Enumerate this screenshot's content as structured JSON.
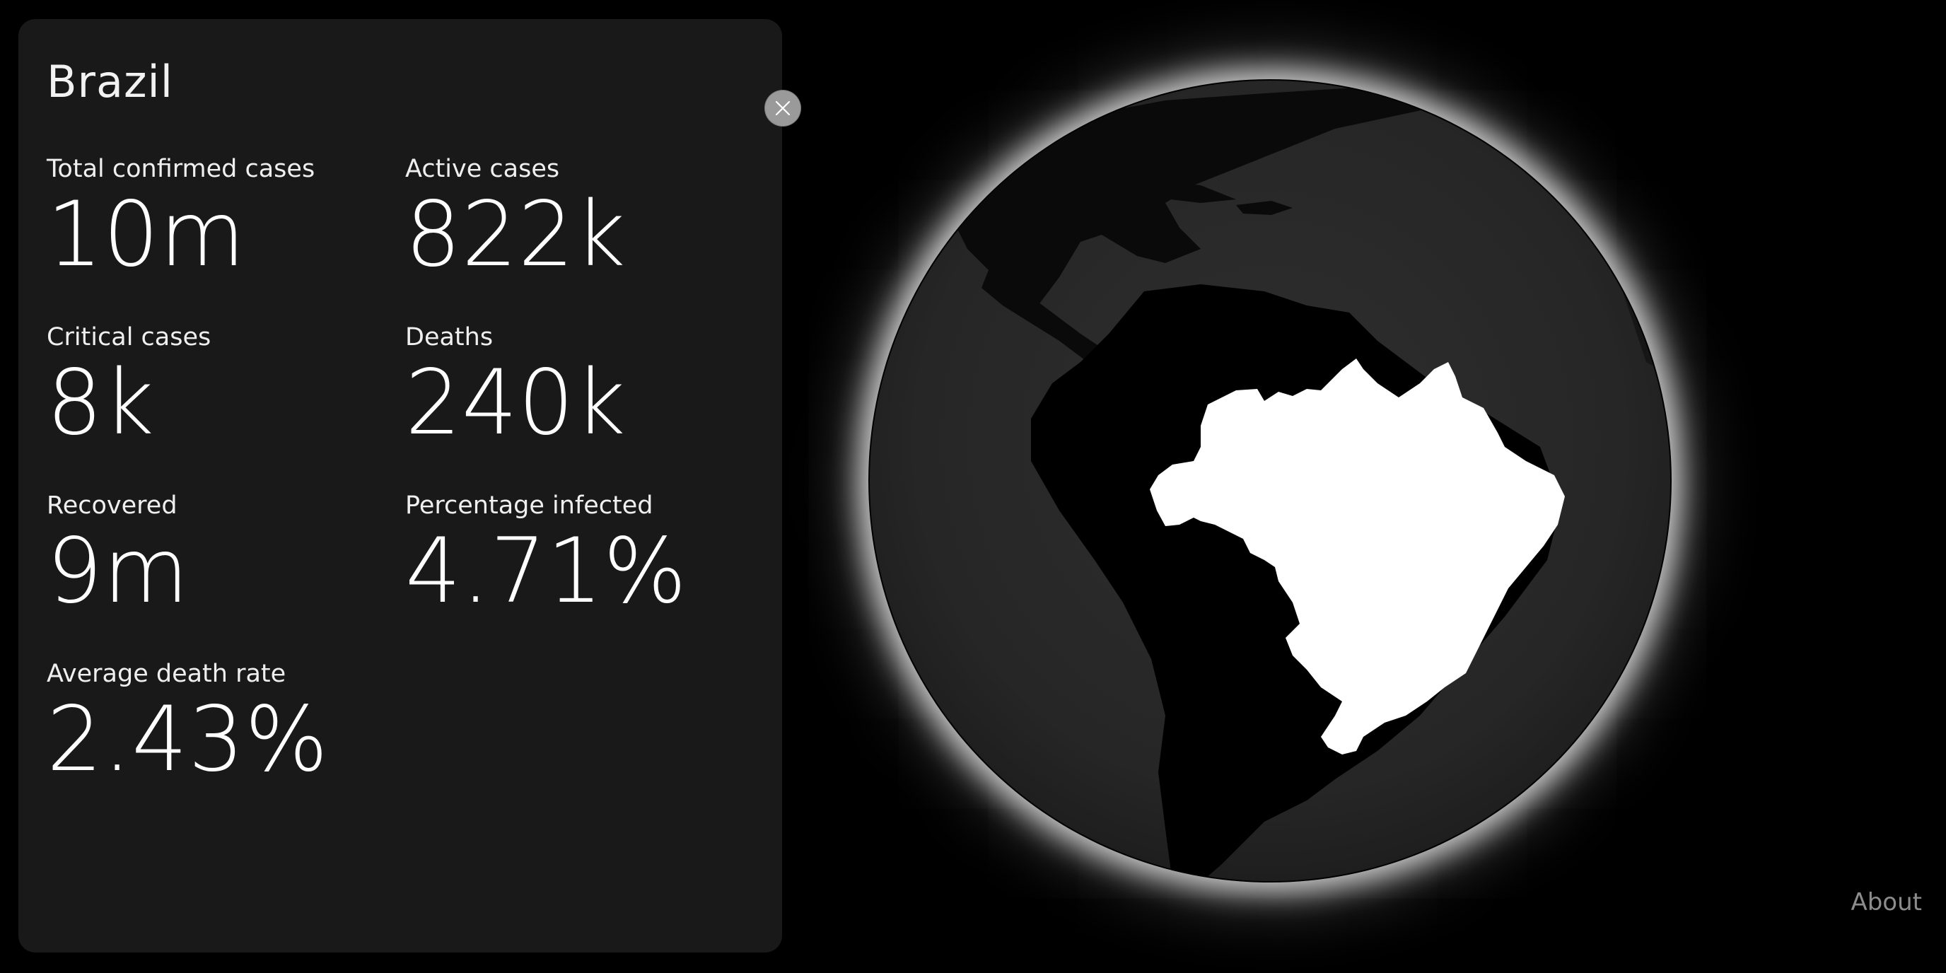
{
  "panel": {
    "country": "Brazil",
    "close_icon": "close-icon",
    "stats": [
      {
        "label": "Total confirmed cases",
        "value": "10m"
      },
      {
        "label": "Active cases",
        "value": "822k"
      },
      {
        "label": "Critical cases",
        "value": "8k"
      },
      {
        "label": "Deaths",
        "value": "240k"
      },
      {
        "label": "Recovered",
        "value": "9m"
      },
      {
        "label": "Percentage infected",
        "value": "4.71%"
      },
      {
        "label": "Average death rate",
        "value": "2.43%"
      }
    ]
  },
  "globe": {
    "highlighted_country": "Brazil",
    "ocean_color": "#2b2b2b",
    "land_color": "#000000",
    "highlight_color": "#ffffff",
    "glow_color": "#ffffff"
  },
  "footer": {
    "about_label": "About"
  }
}
